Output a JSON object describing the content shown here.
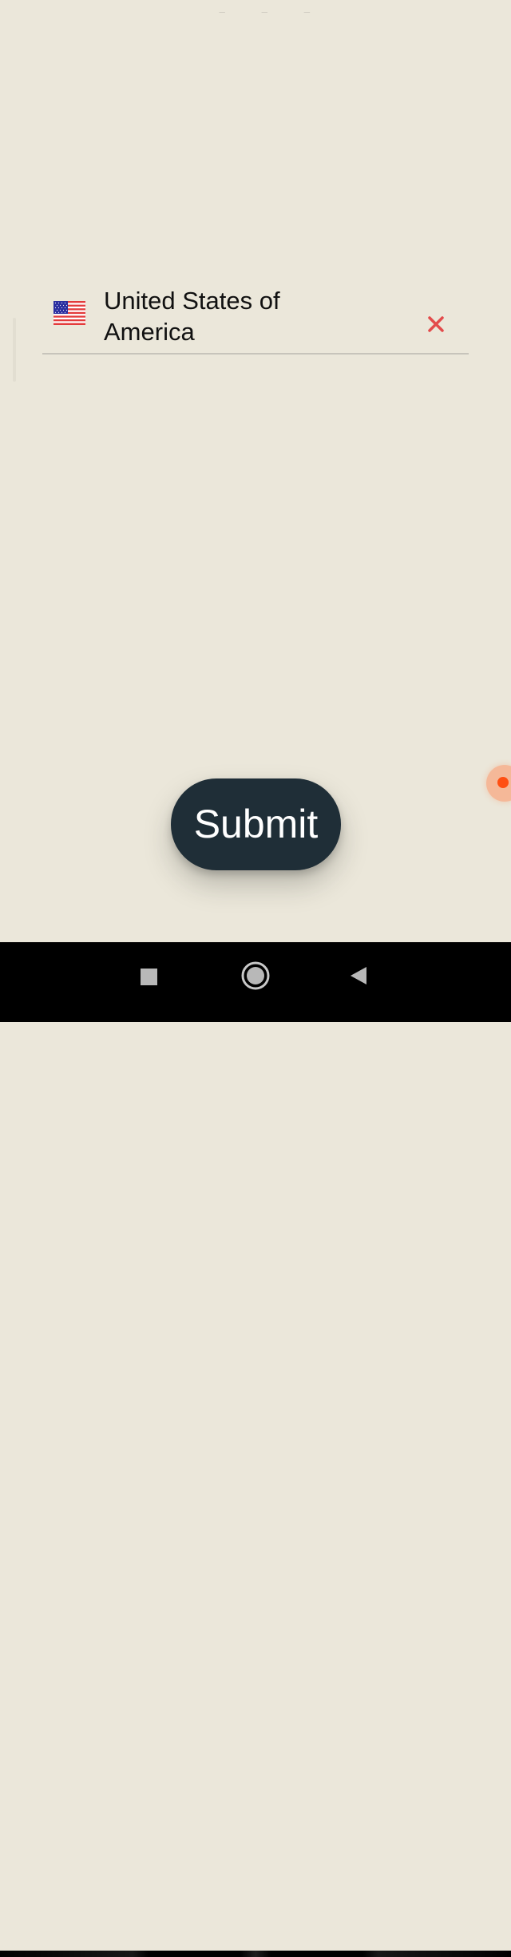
{
  "country_selector": {
    "selected_country": "United States of America",
    "flag_icon": "us-flag-icon",
    "clear_icon": "close-icon",
    "clear_color": "#e34b4b",
    "underline_color": "#c7c4bb"
  },
  "actions": {
    "submit_label": "Submit",
    "submit_color": "#1f2e37"
  },
  "theme": {
    "background": "#ebe7da",
    "floating_dot": "#ff4f12"
  },
  "system_nav": {
    "recents_icon": "square-icon",
    "home_icon": "circle-home-icon",
    "back_icon": "triangle-back-icon"
  }
}
